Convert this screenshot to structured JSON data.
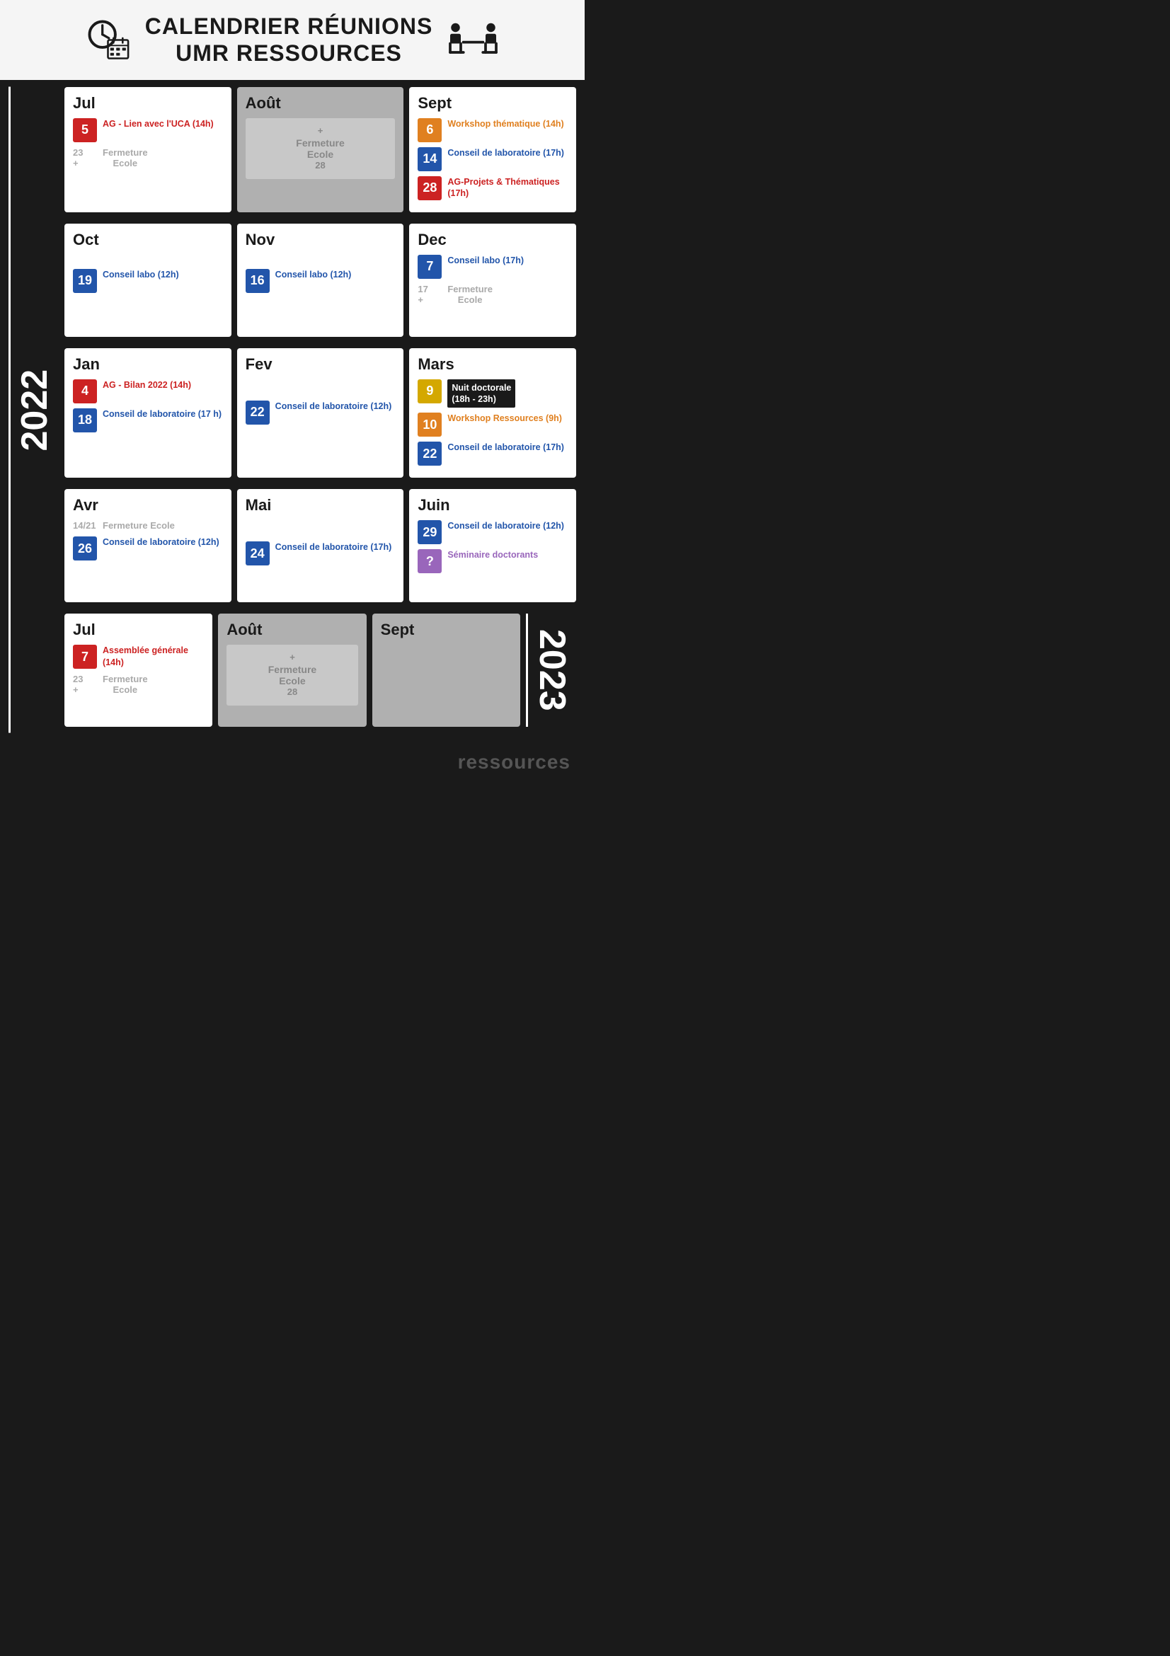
{
  "header": {
    "title_line1": "CALENDRIER RÉUNIONS",
    "title_line2": "UMR RESSOURCES"
  },
  "year2022": {
    "label": "2022",
    "row1": [
      {
        "id": "jul-2022",
        "title": "Jul",
        "type": "white",
        "events": [
          {
            "date": "5",
            "badge": "red",
            "text": "AG - Lien avec l'UCA (14h)",
            "color": "red"
          },
          {
            "type": "fermeture",
            "dates": "23\n+",
            "label": "Fermeture\nEcole"
          }
        ]
      },
      {
        "id": "aout-2022",
        "title": "Août",
        "type": "grey",
        "events": [
          {
            "type": "fermeture-big",
            "dates": "+\n28",
            "label": "Fermeture\nEcole"
          }
        ]
      },
      {
        "id": "sept-2022",
        "title": "Sept",
        "type": "white",
        "events": [
          {
            "date": "6",
            "badge": "orange",
            "text": "Workshop thématique (14h)",
            "color": "orange"
          },
          {
            "date": "14",
            "badge": "blue",
            "text": "Conseil de laboratoire  (17h)",
            "color": "blue"
          },
          {
            "date": "28",
            "badge": "red",
            "text": "AG-Projets & Thématiques (17h)",
            "color": "red"
          }
        ]
      }
    ],
    "row2": [
      {
        "id": "oct-2022",
        "title": "Oct",
        "type": "white",
        "events": [
          {
            "date": "19",
            "badge": "blue",
            "text": "Conseil labo  (12h)",
            "color": "blue"
          }
        ]
      },
      {
        "id": "nov-2022",
        "title": "Nov",
        "type": "white",
        "events": [
          {
            "date": "16",
            "badge": "blue",
            "text": "Conseil labo  (12h)",
            "color": "blue"
          }
        ]
      },
      {
        "id": "dec-2022",
        "title": "Dec",
        "type": "white",
        "events": [
          {
            "date": "7",
            "badge": "blue",
            "text": "Conseil labo  (17h)",
            "color": "blue"
          },
          {
            "type": "fermeture",
            "dates": "17\n+",
            "label": "Fermeture\nEcole"
          }
        ]
      }
    ]
  },
  "year2023_label": "2023",
  "rows_2023": {
    "row1": [
      {
        "id": "jan-2023",
        "title": "Jan",
        "type": "white",
        "events": [
          {
            "date": "4",
            "badge": "red",
            "text": "AG - Bilan 2022 (14h)",
            "color": "red"
          },
          {
            "date": "18",
            "badge": "blue",
            "text": "Conseil de laboratoire (17 h)",
            "color": "blue"
          }
        ]
      },
      {
        "id": "fev-2023",
        "title": "Fev",
        "type": "white",
        "events": [
          {
            "date": "22",
            "badge": "blue",
            "text": "Conseil de laboratoire  (12h)",
            "color": "blue"
          }
        ]
      },
      {
        "id": "mars-2023",
        "title": "Mars",
        "type": "white",
        "events": [
          {
            "date": "9",
            "badge": "yellow",
            "text": "Nuit doctorale\n(18h - 23h)",
            "color": "white",
            "nuit": true
          },
          {
            "date": "10",
            "badge": "orange",
            "text": "Workshop Ressources (9h)",
            "color": "orange"
          },
          {
            "date": "22",
            "badge": "blue",
            "text": "Conseil de laboratoire  (17h)",
            "color": "blue"
          }
        ]
      }
    ],
    "row2": [
      {
        "id": "avr-2023",
        "title": "Avr",
        "type": "white",
        "events": [
          {
            "type": "fermeture",
            "dates": "14/21",
            "label": "Fermeture Ecole"
          },
          {
            "date": "26",
            "badge": "blue",
            "text": "Conseil de laboratoire  (12h)",
            "color": "blue"
          }
        ]
      },
      {
        "id": "mai-2023",
        "title": "Mai",
        "type": "white",
        "events": [
          {
            "date": "24",
            "badge": "blue",
            "text": "Conseil de laboratoire  (17h)",
            "color": "blue"
          }
        ]
      },
      {
        "id": "juin-2023",
        "title": "Juin",
        "type": "white",
        "events": [
          {
            "date": "29",
            "badge": "blue",
            "text": "Conseil de laboratoire  (12h)",
            "color": "blue"
          },
          {
            "date": "?",
            "badge": "purple",
            "text": "Séminaire doctorants",
            "color": "purple"
          }
        ]
      }
    ],
    "row3": [
      {
        "id": "jul-2023",
        "title": "Jul",
        "type": "white",
        "events": [
          {
            "date": "7",
            "badge": "red",
            "text": "Assemblée générale (14h)",
            "color": "red"
          },
          {
            "type": "fermeture",
            "dates": "23\n+",
            "label": "Fermeture\nEcole"
          }
        ]
      },
      {
        "id": "aout-2023",
        "title": "Août",
        "type": "grey",
        "events": [
          {
            "type": "fermeture-big",
            "dates": "+\n28",
            "label": "Fermeture\nEcole"
          }
        ]
      },
      {
        "id": "sept-2023",
        "title": "Sept",
        "type": "grey-empty",
        "events": []
      }
    ]
  },
  "footer": {
    "label": "ressources"
  }
}
